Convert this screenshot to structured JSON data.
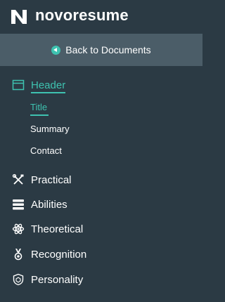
{
  "brand": {
    "name": "novoresume"
  },
  "nav": {
    "back_label": "Back to Documents"
  },
  "sections": [
    {
      "label": "Header",
      "icon": "layout-window-icon",
      "active": true,
      "subitems": [
        {
          "label": "Title",
          "active": true
        },
        {
          "label": "Summary",
          "active": false
        },
        {
          "label": "Contact",
          "active": false
        }
      ]
    },
    {
      "label": "Practical",
      "icon": "crossed-tools-icon"
    },
    {
      "label": "Abilities",
      "icon": "stacked-bars-icon"
    },
    {
      "label": "Theoretical",
      "icon": "atom-icon"
    },
    {
      "label": "Recognition",
      "icon": "medal-icon"
    },
    {
      "label": "Personality",
      "icon": "shield-icon"
    }
  ],
  "colors": {
    "background": "#2b3a44",
    "back_bar": "#4b5d68",
    "accent": "#3ec2b0",
    "text": "#ffffff"
  }
}
